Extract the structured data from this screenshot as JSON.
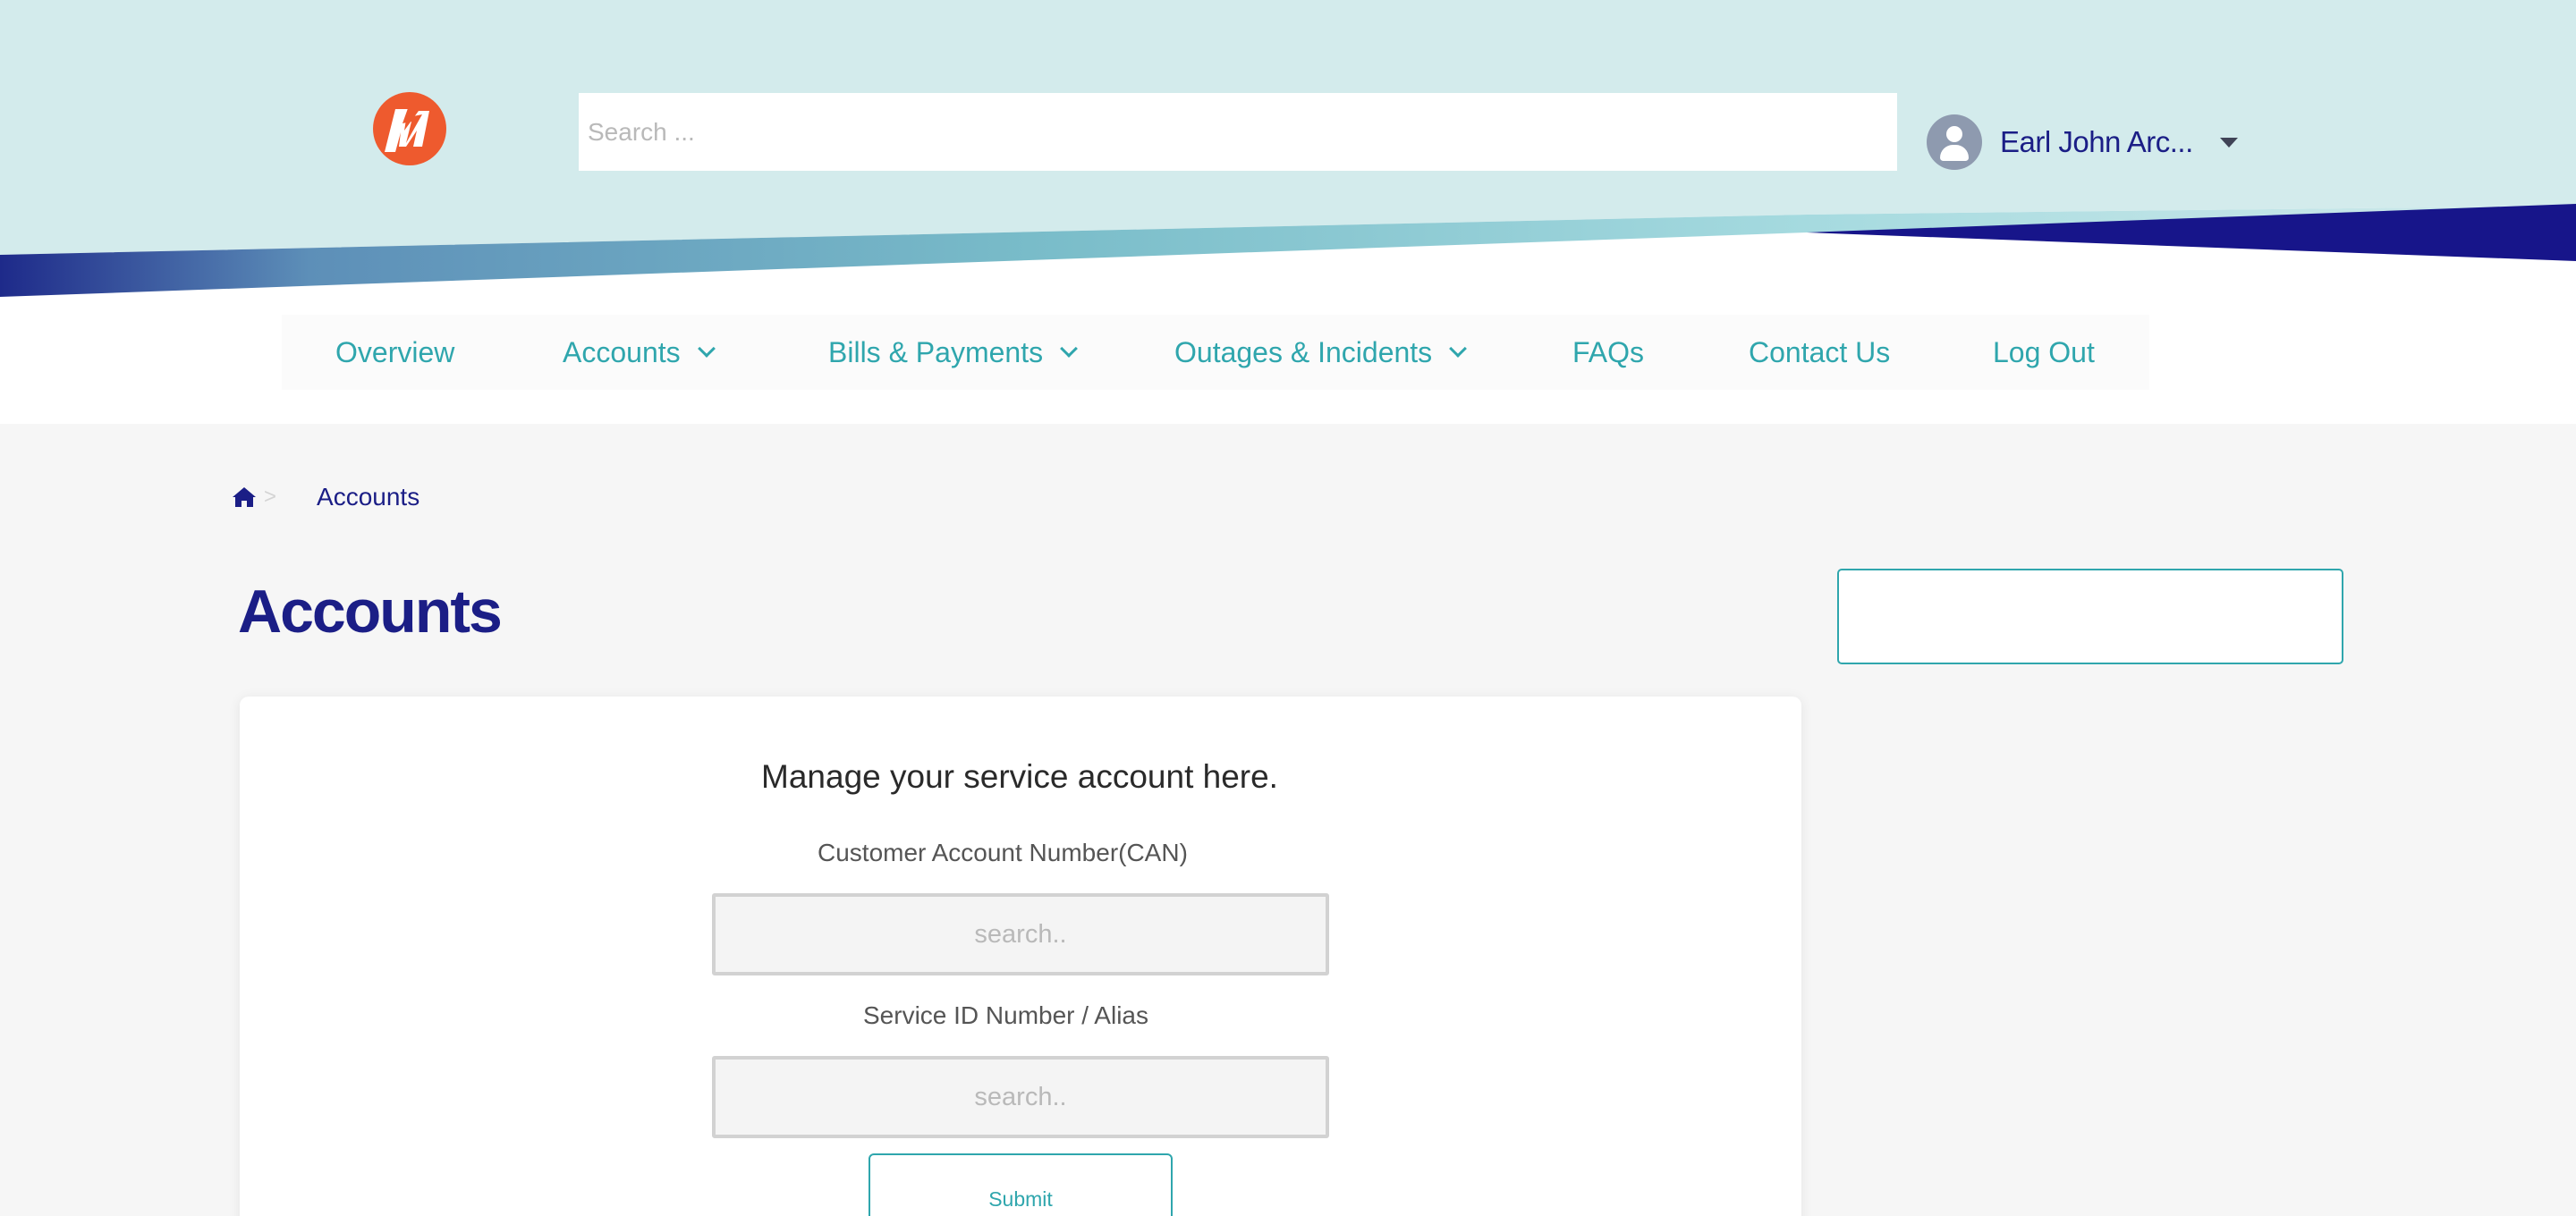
{
  "header": {
    "logo_icon": "bolt-m-logo-icon",
    "search_placeholder": "Search ...",
    "user": {
      "avatar_icon": "user-avatar-icon",
      "name": "Earl John Arc...",
      "caret_icon": "caret-down-icon"
    }
  },
  "nav": {
    "items": [
      {
        "label": "Overview",
        "has_dropdown": false
      },
      {
        "label": "Accounts",
        "has_dropdown": true
      },
      {
        "label": "Bills & Payments",
        "has_dropdown": true
      },
      {
        "label": "Outages & Incidents",
        "has_dropdown": true
      },
      {
        "label": "FAQs",
        "has_dropdown": false
      },
      {
        "label": "Contact Us",
        "has_dropdown": false
      },
      {
        "label": "Log Out",
        "has_dropdown": false
      }
    ]
  },
  "breadcrumb": {
    "home_icon": "home-icon",
    "separator": ">",
    "current": "Accounts"
  },
  "page": {
    "title": "Accounts"
  },
  "form": {
    "heading": "Manage your service account here.",
    "can_label": "Customer Account Number(CAN)",
    "can_placeholder": "search..",
    "service_label": "Service ID Number / Alias",
    "service_placeholder": "search..",
    "submit_label": "Submit"
  },
  "colors": {
    "header_bg": "#d3ebec",
    "brand_navy": "#1b1e86",
    "accent_teal": "#2fa6ad",
    "logo_orange": "#ee5a2e",
    "page_bg": "#f6f6f6"
  }
}
